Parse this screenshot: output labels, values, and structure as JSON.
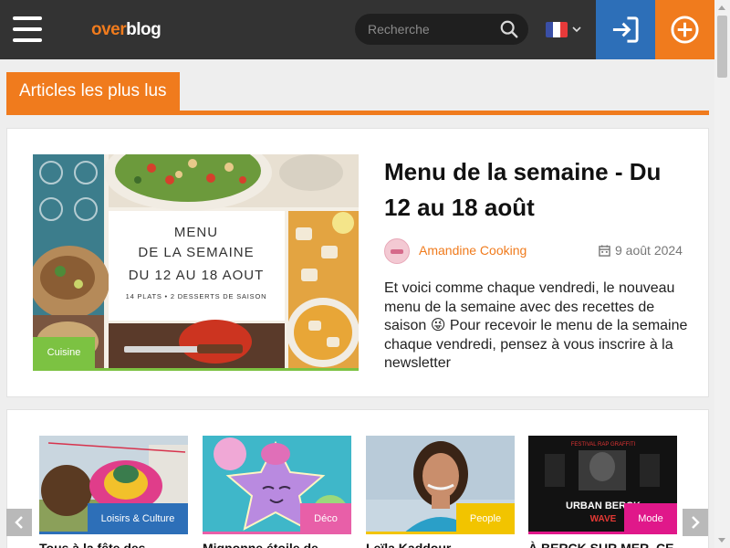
{
  "header": {
    "logo_over": "over",
    "logo_blog": "blog",
    "search_placeholder": "Recherche",
    "colors": {
      "bar": "#333333",
      "accent": "#f07b1d",
      "login": "#2d6fb8"
    },
    "icons": {
      "menu": "hamburger-menu-icon",
      "search": "magnifier-icon",
      "language": "france-flag-icon",
      "login": "sign-in-icon",
      "add": "plus-circle-icon"
    }
  },
  "section": {
    "title": "Articles les plus lus"
  },
  "featured": {
    "category": "Cuisine",
    "category_color": "#7cc242",
    "title": "Menu de la semaine - Du 12 au 18 août",
    "author": "Amandine Cooking",
    "date": "9 août 2024",
    "excerpt": "Et voici comme chaque vendredi, le nouveau menu de la semaine avec des recettes de saison 😜 Pour recevoir le menu de la semaine chaque vendredi, pensez à vous inscrire à la newsletter",
    "image_text": {
      "line1": "MENU",
      "line2": "DE LA SEMAINE",
      "line3": "DU 12 AU 18 AOUT",
      "line4": "14 PLATS • 2 DESSERTS DE SAISON"
    }
  },
  "carousel": {
    "items": [
      {
        "category": "Loisirs & Culture",
        "color": "#2d6fb8",
        "title": "Tous à la fête des"
      },
      {
        "category": "Déco",
        "color": "#e85fa8",
        "title": "Mignonne étoile de"
      },
      {
        "category": "People",
        "color": "#f2c400",
        "title": "Leïla Kaddour"
      },
      {
        "category": "Mode",
        "color": "#e0188a",
        "title": "À BERCK SUR MER, CE"
      }
    ],
    "poster_text": {
      "top": "FESTIVAL RAP GRAFFITI",
      "main": "URBAN BERCK",
      "sub": "WAVE"
    }
  }
}
